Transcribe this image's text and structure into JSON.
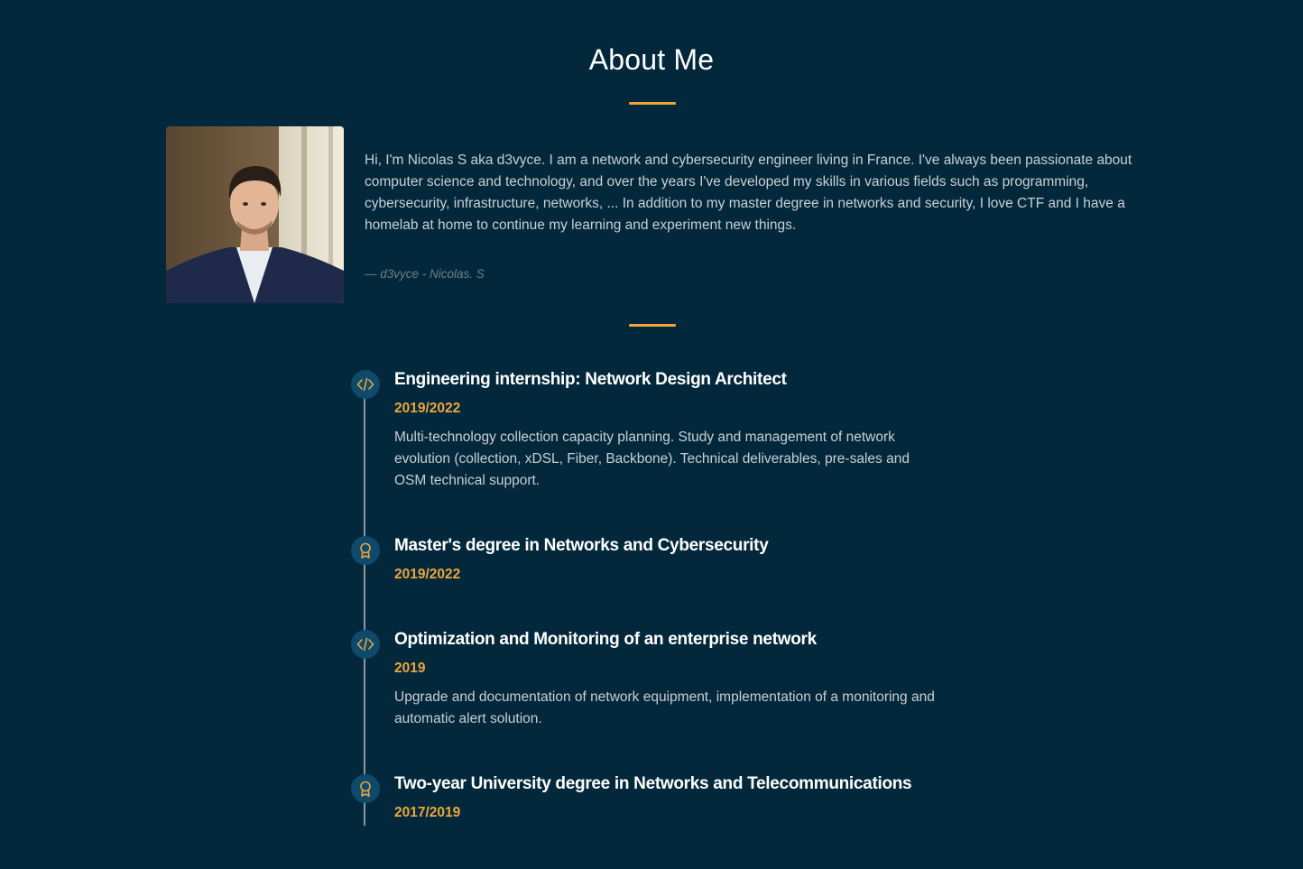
{
  "about": {
    "title": "About Me",
    "bio": "Hi, I'm Nicolas S aka d3vyce. I am a network and cybersecurity engineer living in France. I've always been passionate about computer science and technology, and over the years I've developed my skills in various fields such as programming, cybersecurity, infrastructure, networks, ... In addition to my master degree in networks and security, I love CTF and I have a homelab at home to continue my learning and experiment new things.",
    "signature": "— d3vyce - Nicolas. S"
  },
  "colors": {
    "background": "#03283b",
    "accent": "#eca63c",
    "icon_bg": "#0d4a6b"
  },
  "timeline": [
    {
      "icon": "code-icon",
      "title": "Engineering internship: Network Design Architect",
      "date": "2019/2022",
      "description": "Multi-technology collection capacity planning. Study and management of network evolution (collection, xDSL, Fiber, Backbone). Technical deliverables, pre-sales and OSM technical support."
    },
    {
      "icon": "award-icon",
      "title": "Master's degree in Networks and Cybersecurity",
      "date": "2019/2022",
      "description": ""
    },
    {
      "icon": "code-icon",
      "title": "Optimization and Monitoring of an enterprise network",
      "date": "2019",
      "description": "Upgrade and documentation of network equipment, implementation of a monitoring and automatic alert solution."
    },
    {
      "icon": "award-icon",
      "title": "Two-year University degree in Networks and Telecommunications",
      "date": "2017/2019",
      "description": ""
    }
  ]
}
